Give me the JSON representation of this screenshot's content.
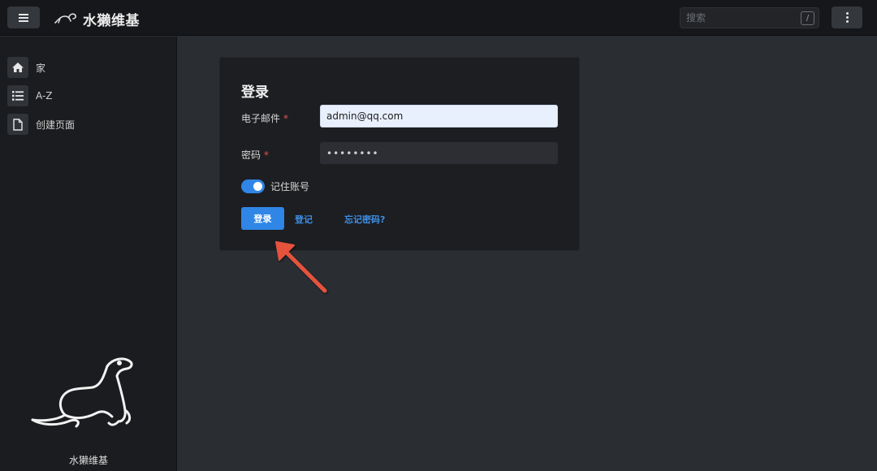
{
  "app": {
    "title": "水獭维基"
  },
  "topbar": {
    "menu_icon": "hamburger-icon",
    "search_placeholder": "搜索",
    "search_shortcut": "/",
    "more_icon": "kebab-menu-icon"
  },
  "sidebar": {
    "items": [
      {
        "label": "家",
        "icon": "home-icon"
      },
      {
        "label": "A-Z",
        "icon": "list-icon"
      },
      {
        "label": "创建页面",
        "icon": "document-icon"
      }
    ],
    "footer_title": "水獭维基"
  },
  "login_form": {
    "title": "登录",
    "email_label": "电子邮件",
    "email_value": "admin@qq.com",
    "password_label": "密码",
    "password_value": "secret12",
    "required_marker": "*",
    "remember_label": "记住账号",
    "remember_checked": true,
    "submit_label": "登录",
    "register_label": "登记",
    "forgot_label": "忘记密码?"
  },
  "colors": {
    "accent": "#2f86e6",
    "annotation_arrow": "#e5533d",
    "required": "#e05353"
  }
}
